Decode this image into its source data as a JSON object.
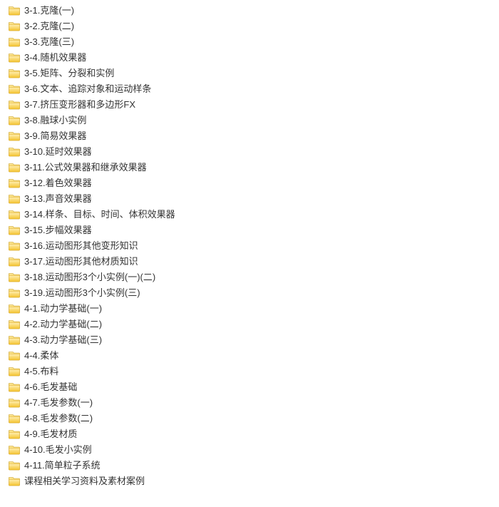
{
  "folders": [
    {
      "name": "3-1.克隆(一)"
    },
    {
      "name": "3-2.克隆(二)"
    },
    {
      "name": "3-3.克隆(三)"
    },
    {
      "name": "3-4.随机效果器"
    },
    {
      "name": "3-5.矩阵、分裂和实例"
    },
    {
      "name": "3-6.文本、追踪对象和运动样条"
    },
    {
      "name": "3-7.挤压变形器和多边形FX"
    },
    {
      "name": "3-8.融球小实例"
    },
    {
      "name": "3-9.简易效果器"
    },
    {
      "name": "3-10.延时效果器"
    },
    {
      "name": "3-11.公式效果器和继承效果器"
    },
    {
      "name": "3-12.着色效果器"
    },
    {
      "name": "3-13.声音效果器"
    },
    {
      "name": "3-14.样条、目标、时间、体积效果器"
    },
    {
      "name": "3-15.步幅效果器"
    },
    {
      "name": "3-16.运动图形其他变形知识"
    },
    {
      "name": "3-17.运动图形其他材质知识"
    },
    {
      "name": "3-18.运动图形3个小实例(一)(二)"
    },
    {
      "name": "3-19.运动图形3个小实例(三)"
    },
    {
      "name": "4-1.动力学基础(一)"
    },
    {
      "name": "4-2.动力学基础(二)"
    },
    {
      "name": "4-3.动力学基础(三)"
    },
    {
      "name": "4-4.柔体"
    },
    {
      "name": "4-5.布料"
    },
    {
      "name": "4-6.毛发基础"
    },
    {
      "name": "4-7.毛发参数(一)"
    },
    {
      "name": "4-8.毛发参数(二)"
    },
    {
      "name": "4-9.毛发材质"
    },
    {
      "name": "4-10.毛发小实例"
    },
    {
      "name": "4-11.简单粒子系统"
    },
    {
      "name": "课程相关学习资料及素材案例"
    }
  ]
}
